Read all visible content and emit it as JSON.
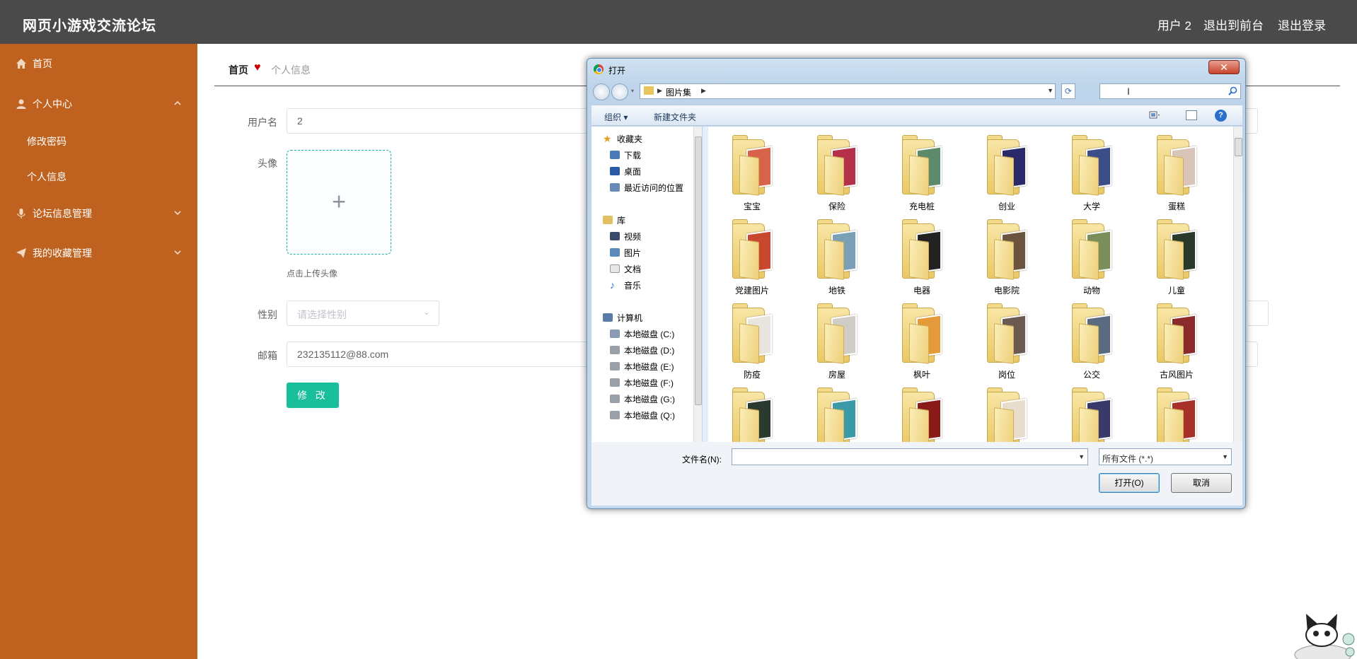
{
  "header": {
    "title": "网页小游戏交流论坛",
    "user": "用户 2",
    "to_front": "退出到前台",
    "logout": "退出登录"
  },
  "sidebar": {
    "items": [
      {
        "label": "首页",
        "icon": "home-icon"
      },
      {
        "label": "个人中心",
        "icon": "user-icon"
      },
      {
        "label": "修改密码"
      },
      {
        "label": "个人信息"
      },
      {
        "label": "论坛信息管理",
        "icon": "mic-icon"
      },
      {
        "label": "我的收藏管理",
        "icon": "send-icon"
      }
    ]
  },
  "breadcrumb": {
    "home": "首页",
    "current": "个人信息"
  },
  "form": {
    "username_label": "用户名",
    "username_value": "2",
    "avatar_label": "头像",
    "upload_tip": "点击上传头像",
    "gender_label": "性别",
    "gender_placeholder": "请选择性别",
    "email_label": "邮箱",
    "email_value": "232135112@88.com",
    "submit": "修 改"
  },
  "dialog": {
    "title": "打开",
    "close": "✕",
    "address": "图片集",
    "toolbar": {
      "organize": "组织",
      "new_folder": "新建文件夹",
      "help": "?"
    },
    "nav": {
      "favorites": "收藏夹",
      "fav_items": [
        "下载",
        "桌面",
        "最近访问的位置"
      ],
      "libraries": "库",
      "lib_items": [
        "视频",
        "图片",
        "文档",
        "音乐"
      ],
      "computer": "计算机",
      "drives": [
        "本地磁盘 (C:)",
        "本地磁盘 (D:)",
        "本地磁盘 (E:)",
        "本地磁盘 (F:)",
        "本地磁盘 (G:)",
        "本地磁盘 (Q:)"
      ]
    },
    "folders": [
      "宝宝",
      "保险",
      "充电桩",
      "创业",
      "大学",
      "蛋糕",
      "党建图片",
      "地铁",
      "电器",
      "电影院",
      "动物",
      "儿童",
      "防疫",
      "房屋",
      "枫叶",
      "岗位",
      "公交",
      "古风图片",
      "",
      "",
      "",
      "",
      "",
      ""
    ],
    "folder_photo_colors": [
      "#d9634a",
      "#b5314a",
      "#5d8a6a",
      "#2a2a6a",
      "#3b4e8a",
      "#d8c4b8",
      "#c9472e",
      "#7aa0b8",
      "#222222",
      "#6a5440",
      "#7a8e5c",
      "#2a3a2a",
      "#e8e4de",
      "#d0ccc8",
      "#e59a3a",
      "#6a5a50",
      "#5a6a80",
      "#8a2a2a",
      "#2a3a30",
      "#3a9aa8",
      "#8a1a1a",
      "#e8dccc",
      "#3a3a6a",
      "#a8302a"
    ],
    "filename_label": "文件名(N):",
    "filetype": "所有文件 (*.*)",
    "open_button": "打开(O)",
    "cancel_button": "取消"
  }
}
